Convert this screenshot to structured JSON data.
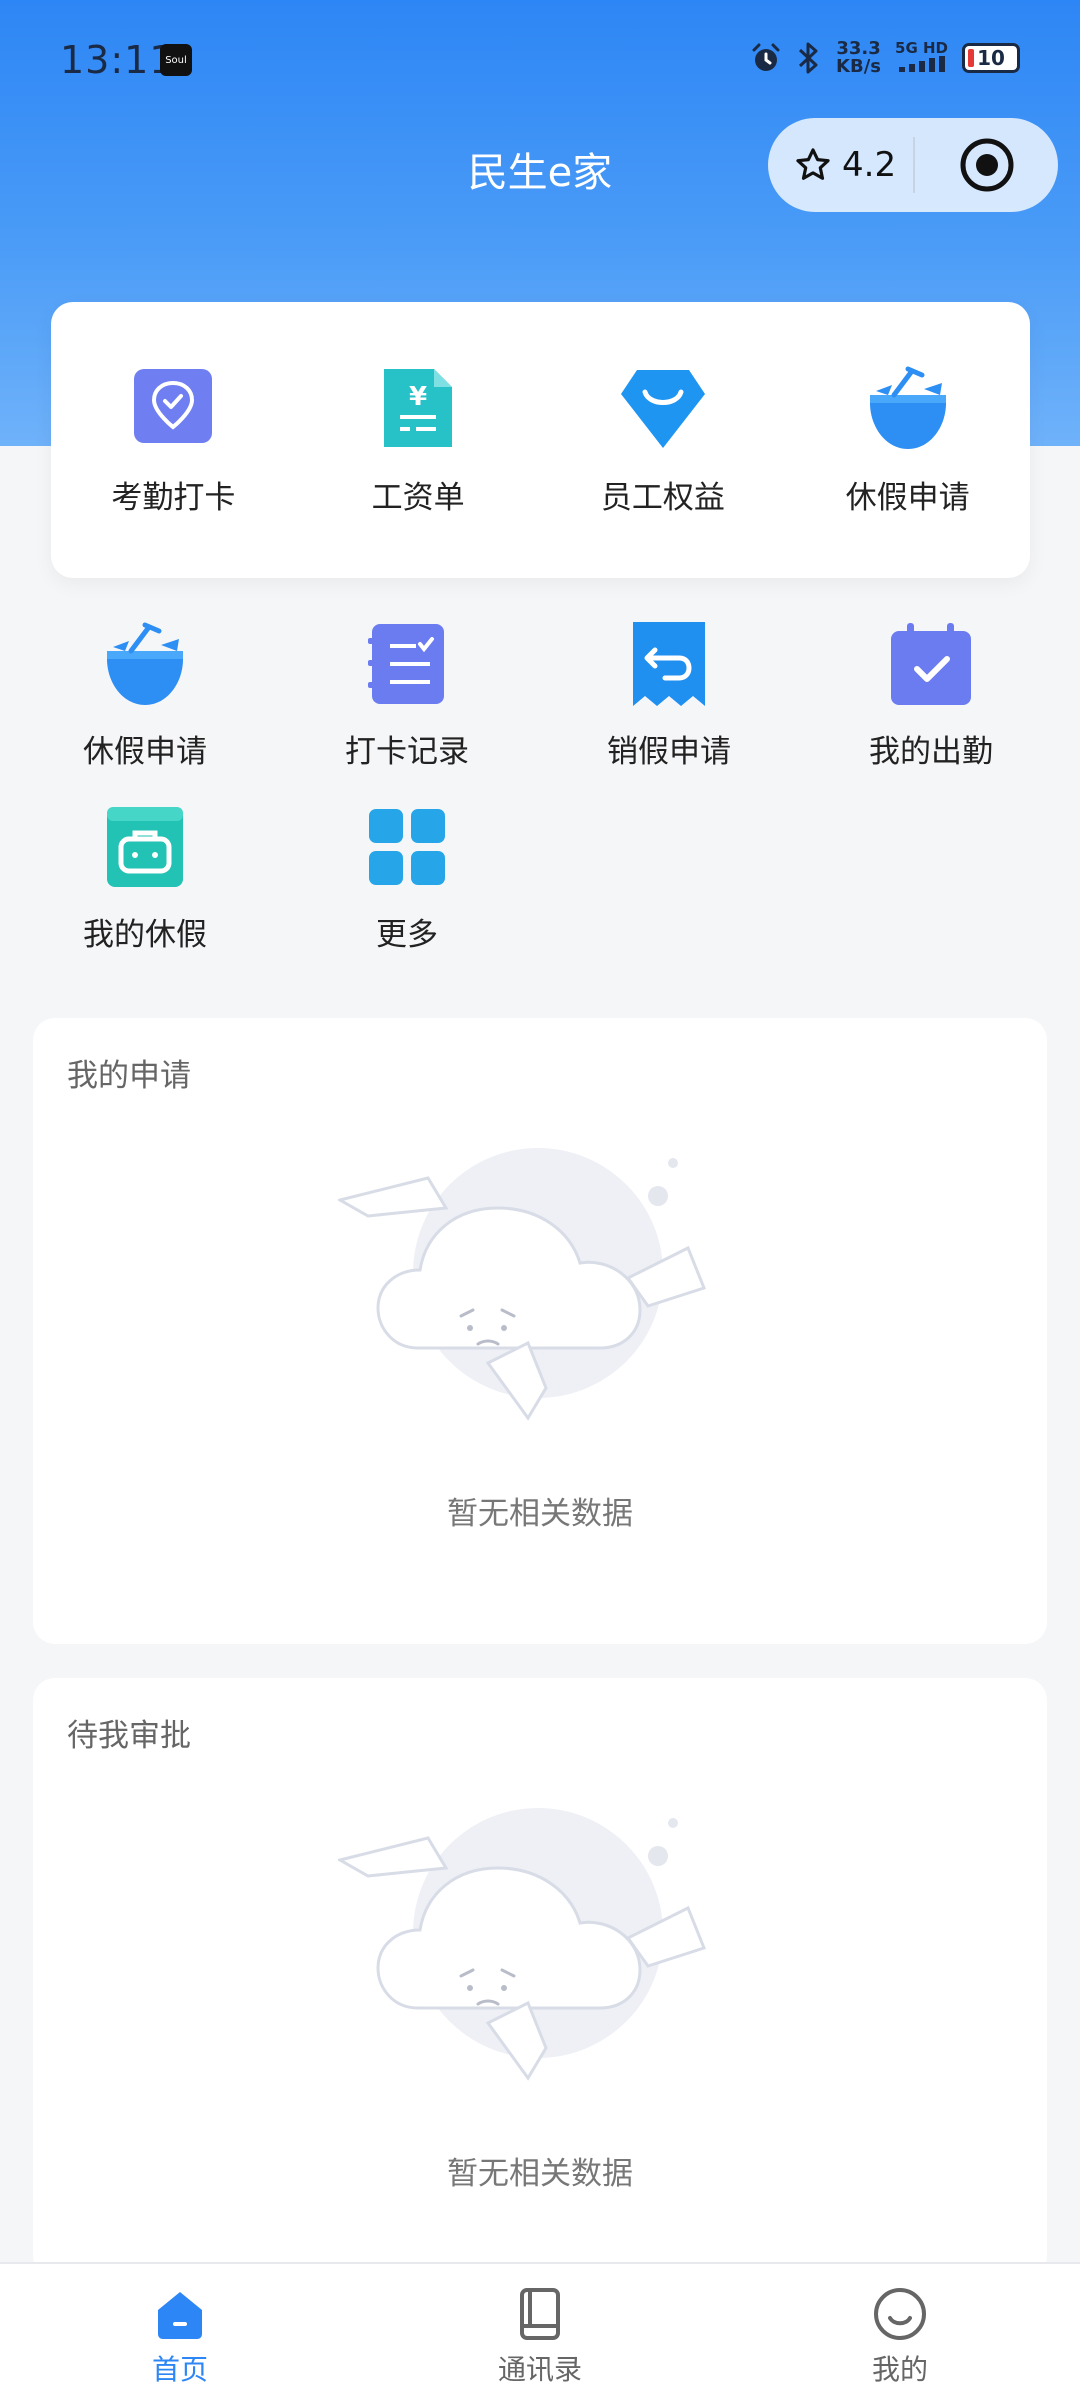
{
  "status_bar": {
    "time": "13:11",
    "app_badge": "Soul",
    "net_speed_value": "33.3",
    "net_speed_unit": "KB/s",
    "signal_label": "5G HD",
    "battery": "10"
  },
  "header": {
    "title": "民生e家",
    "rating": "4.2"
  },
  "top_shortcuts": [
    {
      "label": "考勤打卡",
      "icon": "location-check-icon",
      "color": "#6f7ef0"
    },
    {
      "label": "工资单",
      "icon": "payslip-icon",
      "color": "#27c1c8"
    },
    {
      "label": "员工权益",
      "icon": "benefit-bag-icon",
      "color": "#1f95f2"
    },
    {
      "label": "休假申请",
      "icon": "coconut-drink-icon",
      "color": "#2d8ef4"
    }
  ],
  "shortcuts": [
    {
      "label": "休假申请",
      "icon": "coconut-drink-icon"
    },
    {
      "label": "打卡记录",
      "icon": "checklist-icon"
    },
    {
      "label": "销假申请",
      "icon": "return-receipt-icon"
    },
    {
      "label": "我的出勤",
      "icon": "calendar-check-icon"
    },
    {
      "label": "我的休假",
      "icon": "suitcase-icon"
    },
    {
      "label": "更多",
      "icon": "grid-more-icon"
    }
  ],
  "panels": {
    "my_requests": {
      "title": "我的申请",
      "empty": "暂无相关数据"
    },
    "pending_approval": {
      "title": "待我审批",
      "empty": "暂无相关数据"
    }
  },
  "tabbar": {
    "items": [
      {
        "label": "首页",
        "icon": "home-icon",
        "active": true
      },
      {
        "label": "通讯录",
        "icon": "address-book-icon",
        "active": false
      },
      {
        "label": "我的",
        "icon": "smile-profile-icon",
        "active": false
      }
    ]
  },
  "colors": {
    "brand_blue": "#2d86f5",
    "background": "#f5f6f8"
  }
}
